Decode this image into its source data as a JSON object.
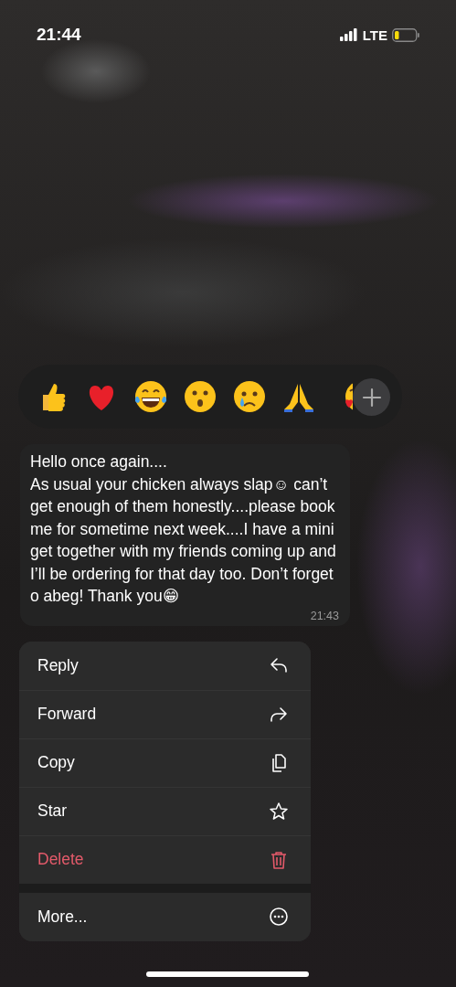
{
  "status_bar": {
    "time": "21:44",
    "network": "LTE"
  },
  "message": {
    "text": "Hello once again....\nAs usual your chicken always slap☺ can’t get enough of them honestly....please book me for sometime next week....I have a mini get together with my friends coming up and I’ll be ordering for that day too. Don’t forget o abeg! Thank you😁",
    "time": "21:43"
  },
  "menu": [
    {
      "label": "Reply",
      "kind": "action"
    },
    {
      "label": "Forward",
      "kind": "action"
    },
    {
      "label": "Copy",
      "kind": "action"
    },
    {
      "label": "Star",
      "kind": "action"
    },
    {
      "label": "Delete",
      "kind": "destructive"
    },
    {
      "label": "More...",
      "kind": "separated"
    }
  ]
}
